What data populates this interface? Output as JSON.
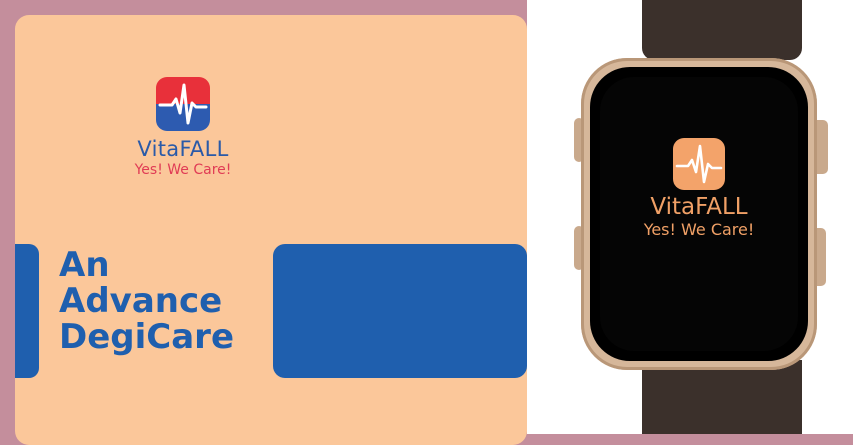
{
  "card": {
    "brand_name": "VitaFALL",
    "tagline": "Yes! We Care!",
    "headline": [
      "An",
      "Advance",
      "DegiCare"
    ]
  },
  "watch": {
    "brand_name": "VitaFALL",
    "tagline": "Yes! We Care!"
  },
  "colors": {
    "background": "#c48e9c",
    "card": "#fbc79a",
    "brand_blue": "#1f5fae",
    "accent_red": "#e03c55",
    "watch_text": "#f0a066"
  },
  "icons": {
    "card_logo": "heartbeat-app-icon",
    "watch_logo": "heartbeat-app-icon"
  }
}
